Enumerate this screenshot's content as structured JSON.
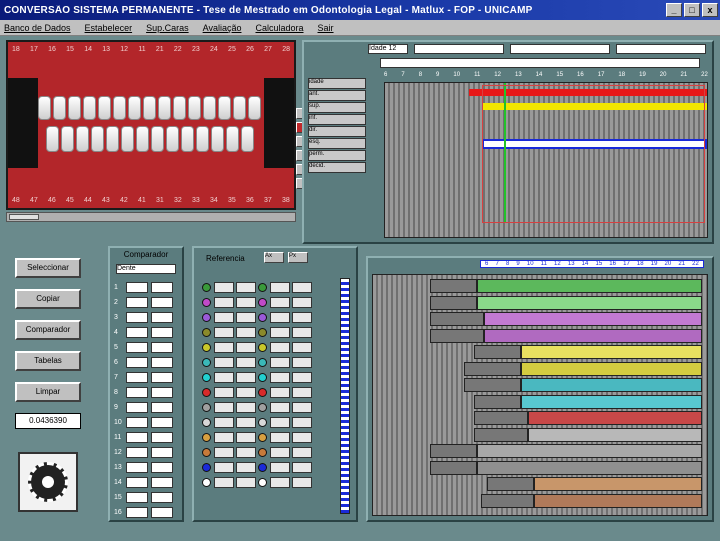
{
  "window": {
    "title": "CONVERSÃO SISTEMA PERMANENTE - Tese de Mestrado em Odontologia Legal  -  Matlux  -  FOP - UNICAMP",
    "min_label": "_",
    "max_label": "□",
    "close_label": "x"
  },
  "menu": [
    "Banco de Dados",
    "Estabelecer",
    "Sup.Caras",
    "Avaliação",
    "Calculadora",
    "Sair"
  ],
  "photo": {
    "upper_numbers": [
      "18",
      "17",
      "16",
      "15",
      "14",
      "13",
      "12",
      "11",
      "21",
      "22",
      "23",
      "24",
      "25",
      "26",
      "27",
      "28"
    ],
    "lower_numbers": [
      "48",
      "47",
      "46",
      "45",
      "44",
      "43",
      "42",
      "41",
      "31",
      "32",
      "33",
      "34",
      "35",
      "36",
      "37",
      "38"
    ]
  },
  "top_chart": {
    "field_label": "Idade 12",
    "axis": [
      "6",
      "7",
      "8",
      "9",
      "10",
      "11",
      "12",
      "13",
      "14",
      "15",
      "16",
      "17",
      "18",
      "19",
      "20",
      "21",
      "22"
    ],
    "row_labels": [
      "idade",
      "ant.",
      "sup.",
      "inf.",
      "dir.",
      "esq.",
      "perm.",
      "decid."
    ],
    "colors": {
      "red": "#e81818",
      "yellow": "#f2e600",
      "green": "#22c22a",
      "blue": "#1a2ad8"
    }
  },
  "buttons": {
    "b1": "Seleccionar",
    "b2": "Copiar",
    "b3": "Comparador",
    "b4": "Tabelas",
    "b5": "Limpar",
    "value": "0.0436390"
  },
  "comparador": {
    "title": "Comparador",
    "selector": "Dente",
    "rows": [
      "1",
      "2",
      "3",
      "4",
      "5",
      "6",
      "7",
      "8",
      "9",
      "10",
      "11",
      "12",
      "13",
      "14",
      "15",
      "16"
    ]
  },
  "referencia": {
    "title": "Referencia",
    "buttons": [
      "Ax",
      "Px"
    ],
    "dot_colors_left": [
      "#3a9a3a",
      "#c04ac8",
      "#9a5ad8",
      "#8a8a2a",
      "#c8c82a",
      "#3ab8b8",
      "#22d0d0",
      "#d82a2a",
      "#a0a0a0",
      "#d8d8d8",
      "#d8a040",
      "#c87a3a",
      "#1a2ad8",
      "#ffffff"
    ],
    "dot_colors_right": [
      "#3a9a3a",
      "#c04ac8",
      "#9a5ad8",
      "#8a8a2a",
      "#c8c82a",
      "#3ab8b8",
      "#22d0d0",
      "#d82a2a",
      "#a0a0a0",
      "#d8d8d8",
      "#d8a040",
      "#c87a3a",
      "#1a2ad8",
      "#ffffff"
    ]
  },
  "bottom_chart": {
    "axis": [
      "6",
      "7",
      "8",
      "9",
      "10",
      "11",
      "12",
      "13",
      "14",
      "15",
      "16",
      "17",
      "18",
      "19",
      "20",
      "21",
      "22"
    ],
    "bars": [
      {
        "start": 0.17,
        "mid": 0.31,
        "color": "#5cb85c"
      },
      {
        "start": 0.17,
        "mid": 0.31,
        "color": "#8ad88a"
      },
      {
        "start": 0.17,
        "mid": 0.33,
        "color": "#c27ad2"
      },
      {
        "start": 0.17,
        "mid": 0.33,
        "color": "#b06ac0"
      },
      {
        "start": 0.3,
        "mid": 0.44,
        "color": "#e8e060"
      },
      {
        "start": 0.27,
        "mid": 0.44,
        "color": "#d4cc40"
      },
      {
        "start": 0.27,
        "mid": 0.44,
        "color": "#4ab8c0"
      },
      {
        "start": 0.3,
        "mid": 0.44,
        "color": "#58c8d0"
      },
      {
        "start": 0.3,
        "mid": 0.46,
        "color": "#c84848"
      },
      {
        "start": 0.3,
        "mid": 0.46,
        "color": "#b8b8b8"
      },
      {
        "start": 0.17,
        "mid": 0.31,
        "color": "#a8a8a8"
      },
      {
        "start": 0.17,
        "mid": 0.31,
        "color": "#909090"
      },
      {
        "start": 0.34,
        "mid": 0.48,
        "color": "#c8966a"
      },
      {
        "start": 0.32,
        "mid": 0.48,
        "color": "#b07a5a"
      }
    ]
  }
}
